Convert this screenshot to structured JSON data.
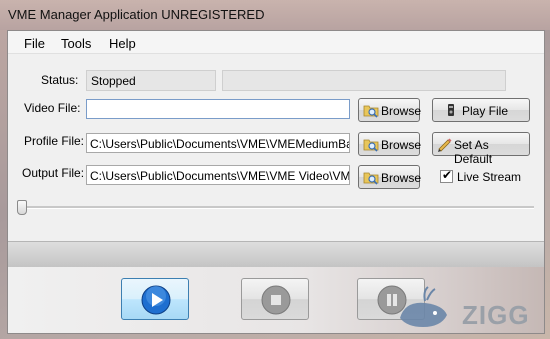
{
  "window": {
    "title": "VME Manager Application UNREGISTERED"
  },
  "menu": {
    "items": [
      "File",
      "Tools",
      "Help"
    ]
  },
  "status": {
    "label": "Status:",
    "value": "Stopped",
    "secondary_value": ""
  },
  "video_file": {
    "label": "Video File:",
    "value": "",
    "browse_label": "Browse"
  },
  "profile_file": {
    "label": "Profile File:",
    "value": "C:\\Users\\Public\\Documents\\VME\\VMEMediumBandw",
    "browse_label": "Browse"
  },
  "output_file": {
    "label": "Output File:",
    "value": "C:\\Users\\Public\\Documents\\VME\\VME Video\\VMEEr",
    "browse_label": "Browse"
  },
  "actions": {
    "play_file_label": "Play File",
    "set_default_label": "Set As Default"
  },
  "live_stream": {
    "label": "Live Stream",
    "checked": true
  },
  "seek": {
    "position": 0
  },
  "progress": {
    "value": 0
  },
  "controls": {
    "play": "play-icon",
    "stop": "stop-icon",
    "pause": "pause-icon"
  },
  "watermark": {
    "text": "ZIGG"
  },
  "colors": {
    "accent": "#1e6fd0",
    "window_bg": "#f0f0f0"
  }
}
